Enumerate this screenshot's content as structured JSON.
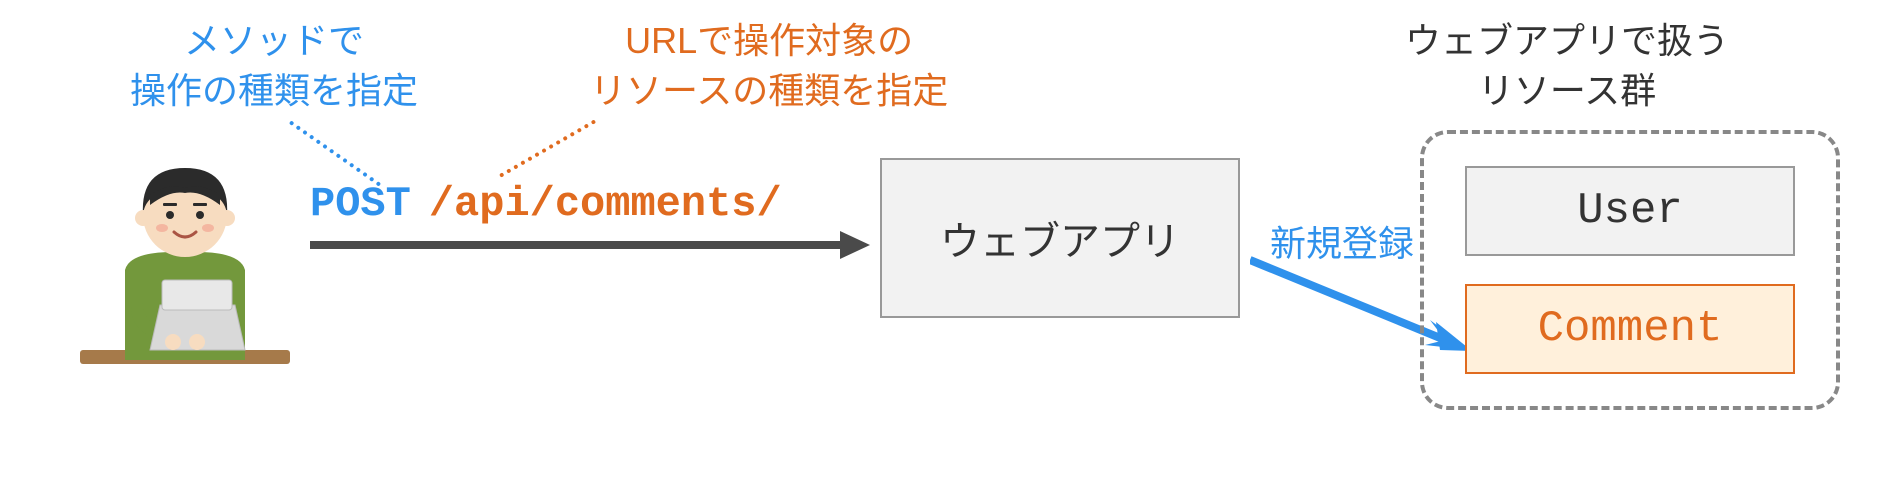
{
  "annotations": {
    "method": "メソッドで\n操作の種類を指定",
    "url": "URLで操作対象の\nリソースの種類を指定",
    "resources": "ウェブアプリで扱う\nリソース群"
  },
  "request": {
    "method": "POST",
    "path": "/api/comments/"
  },
  "webapp": {
    "label": "ウェブアプリ"
  },
  "arrows": {
    "register_label": "新規登録"
  },
  "resource_boxes": {
    "user": "User",
    "comment": "Comment"
  }
}
